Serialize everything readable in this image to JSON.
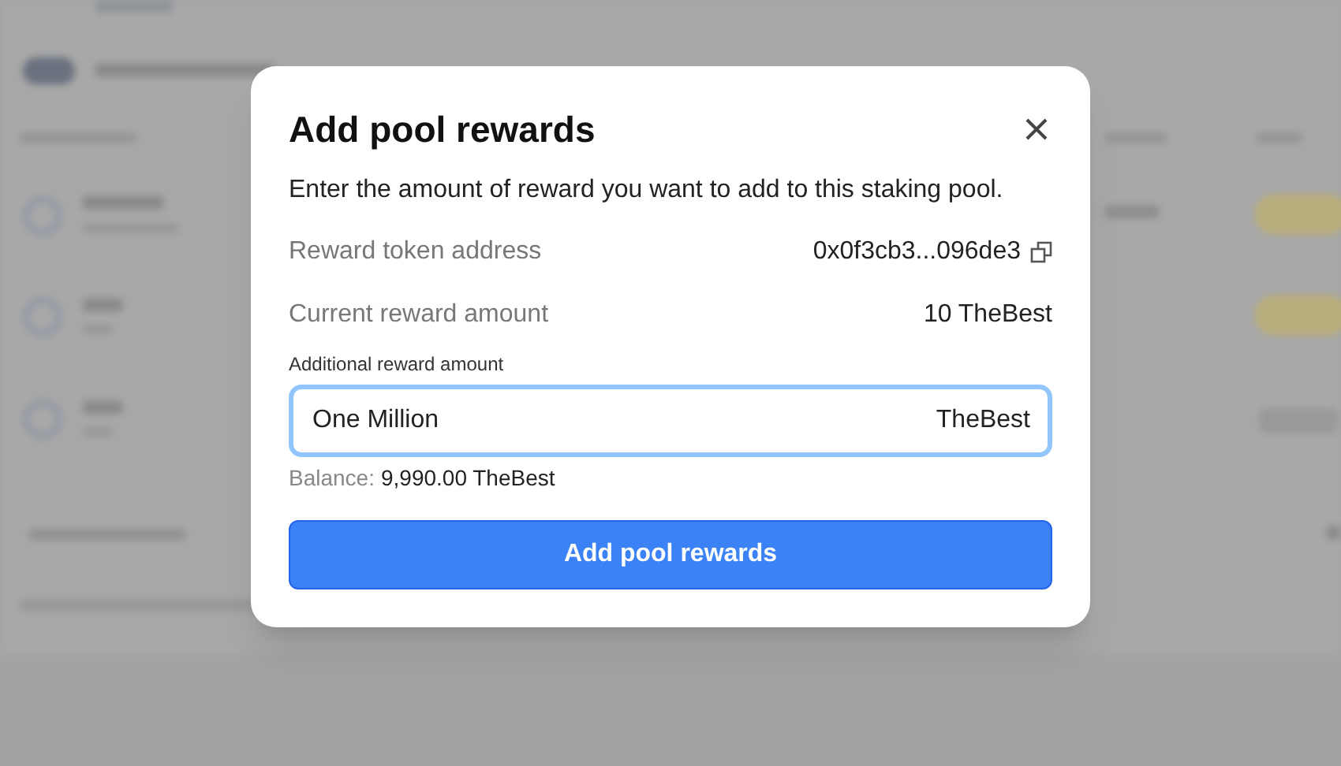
{
  "dialog": {
    "title": "Add pool rewards",
    "description": "Enter the amount of reward you want to add to this staking pool.",
    "details": [
      {
        "label": "Reward token address",
        "value": "0x0f3cb3...096de3",
        "copyable": true
      },
      {
        "label": "Current reward amount",
        "value": "10 TheBest",
        "copyable": false
      }
    ],
    "amount_field": {
      "label": "Additional reward amount",
      "value": "One Million",
      "suffix": "TheBest",
      "focused": true
    },
    "balance": {
      "label": "Balance:",
      "value": "9,990.00 TheBest"
    },
    "submit_button": "Add pool rewards"
  }
}
